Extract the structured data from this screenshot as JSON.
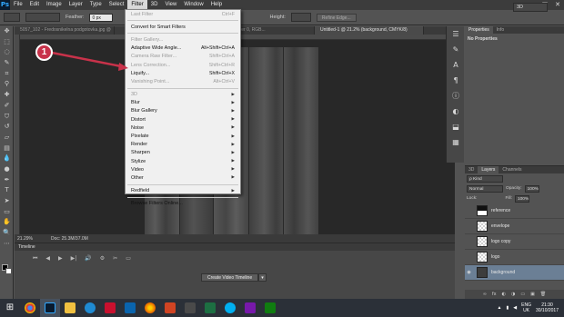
{
  "menubar": {
    "logo": "Ps",
    "items": [
      "File",
      "Edit",
      "Image",
      "Layer",
      "Type",
      "Select",
      "Filter",
      "3D",
      "View",
      "Window",
      "Help"
    ],
    "active": "Filter",
    "window_controls": [
      "–",
      "□",
      "✕"
    ]
  },
  "options": {
    "feather_label": "Feather:",
    "feather_value": "0 px",
    "height_label": "Height:",
    "refine_edge": "Refine Edge...",
    "workspace": "3D"
  },
  "documents": {
    "tabs": [
      "5057_102 - Fredosnikelna podgotovka.jpg @",
      "...png @ 100% (Layer 0, RGB...",
      "Untitled-1 @ 21.2% (background, CMYK/8)"
    ],
    "status_zoom": "21.29%",
    "status_doc": "Doc: 25.3M/37.0M"
  },
  "filter_menu": {
    "items": [
      {
        "label": "Last Filter",
        "shortcut": "Ctrl+F",
        "disabled": true
      },
      {
        "sep": true
      },
      {
        "label": "Convert for Smart Filters",
        "shortcut": ""
      },
      {
        "sep": true
      },
      {
        "label": "Filter Gallery...",
        "shortcut": "",
        "disabled": true
      },
      {
        "label": "Adaptive Wide Angle...",
        "shortcut": "Alt+Shift+Ctrl+A"
      },
      {
        "label": "Camera Raw Filter...",
        "shortcut": "Shift+Ctrl+A",
        "disabled": true
      },
      {
        "label": "Lens Correction...",
        "shortcut": "Shift+Ctrl+R",
        "disabled": true
      },
      {
        "label": "Liquify...",
        "shortcut": "Shift+Ctrl+X"
      },
      {
        "label": "Vanishing Point...",
        "shortcut": "Alt+Ctrl+V",
        "disabled": true
      },
      {
        "sep": true
      },
      {
        "label": "3D",
        "submenu": true,
        "disabled": true
      },
      {
        "label": "Blur",
        "submenu": true
      },
      {
        "label": "Blur Gallery",
        "submenu": true
      },
      {
        "label": "Distort",
        "submenu": true
      },
      {
        "label": "Noise",
        "submenu": true
      },
      {
        "label": "Pixelate",
        "submenu": true
      },
      {
        "label": "Render",
        "submenu": true
      },
      {
        "label": "Sharpen",
        "submenu": true
      },
      {
        "label": "Stylize",
        "submenu": true
      },
      {
        "label": "Video",
        "submenu": true
      },
      {
        "label": "Other",
        "submenu": true
      },
      {
        "sep": true
      },
      {
        "label": "Redfield",
        "submenu": true
      },
      {
        "sep": true
      },
      {
        "label": "Browse Filters Online...",
        "shortcut": ""
      }
    ]
  },
  "annotation": {
    "number": "1",
    "color": "#c8324a"
  },
  "timeline": {
    "title": "Timeline",
    "controls": [
      "⏮",
      "◀",
      "▶",
      "▶|",
      "🔊",
      "⚙",
      "✂",
      "▭"
    ],
    "create_button": "Create Video Timeline",
    "dropdown": "▾"
  },
  "properties_panel": {
    "tabs": [
      "Properties",
      "Info"
    ],
    "content": "No Properties"
  },
  "layers_panel": {
    "tabs": [
      "3D",
      "Layers",
      "Channels"
    ],
    "kind": "ρ Kind",
    "blend_mode": "Normal",
    "opacity_label": "Opacity:",
    "opacity_value": "100%",
    "lock_label": "Lock:",
    "fill_label": "Fill:",
    "fill_value": "100%",
    "layers": [
      {
        "name": "reference",
        "thumb": "ref",
        "visible": false
      },
      {
        "name": "envelope",
        "thumb": "checker",
        "visible": false
      },
      {
        "name": "logo copy",
        "thumb": "checker",
        "visible": false
      },
      {
        "name": "logo",
        "thumb": "checker",
        "visible": false
      },
      {
        "name": "background",
        "thumb": "dark",
        "visible": true,
        "selected": true
      }
    ],
    "footer_icons": [
      "∞",
      "fx",
      "◐",
      "◑",
      "▭",
      "▣",
      "🗑"
    ]
  },
  "taskbar": {
    "language": "ENG",
    "locale": "UK",
    "time": "21:30",
    "date": "30/10/2017"
  }
}
